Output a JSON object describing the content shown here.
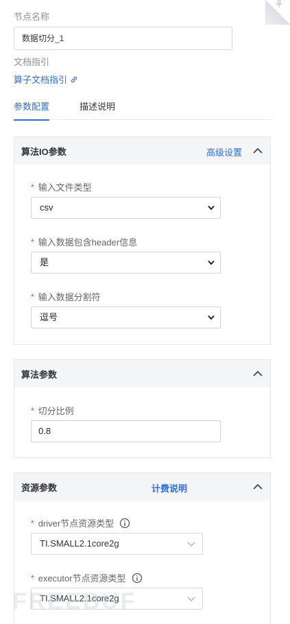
{
  "node": {
    "name_label": "节点名称",
    "name_value": "数据切分_1",
    "doc_label": "文档指引",
    "doc_link": "算子文档指引"
  },
  "tabs": [
    {
      "label": "参数配置",
      "active": true
    },
    {
      "label": "描述说明",
      "active": false
    }
  ],
  "io_section": {
    "title": "算法IO参数",
    "link": "高级设置",
    "fields": [
      {
        "label": "输入文件类型",
        "value": "csv"
      },
      {
        "label": "输入数据包含header信息",
        "value": "是"
      },
      {
        "label": "输入数据分割符",
        "value": "逗号"
      }
    ]
  },
  "algo_section": {
    "title": "算法参数",
    "field_label": "切分比例",
    "field_value": "0.8"
  },
  "resource_section": {
    "title": "资源参数",
    "link": "计费说明",
    "fields": [
      {
        "label": "driver节点资源类型",
        "value": "TI.SMALL2.1core2g"
      },
      {
        "label": "executor节点资源类型",
        "value": "TI.SMALL2.1core2g"
      }
    ]
  },
  "watermark": "FREEBUF",
  "colors": {
    "accent": "#2b6ee6",
    "required": "#e54545",
    "header_bg": "#f4f5f7"
  }
}
